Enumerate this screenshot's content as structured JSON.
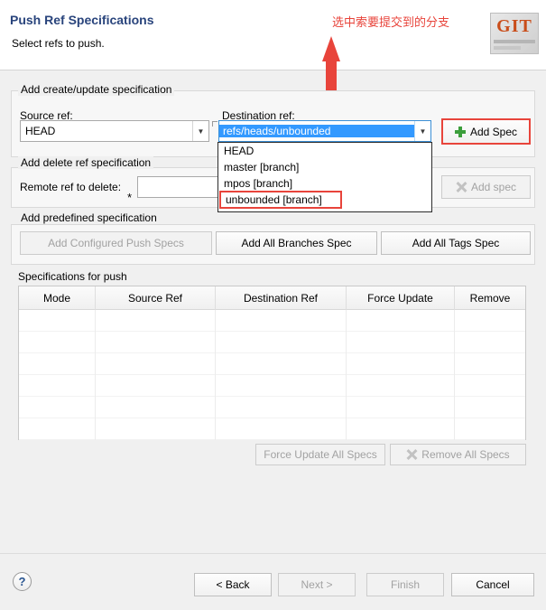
{
  "header": {
    "title": "Push Ref Specifications",
    "subtitle": "Select refs to push.",
    "logo_text": "GIT"
  },
  "annotation": {
    "text": "选中索要提交到的分支",
    "color": "#e8443b"
  },
  "groups": {
    "create_update": {
      "title": "Add create/update specification",
      "source_ref_label": "Source ref:",
      "source_ref_value": "HEAD",
      "destination_ref_label": "Destination ref:",
      "destination_ref_value": "refs/heads/unbounded",
      "add_spec_button": "Add Spec",
      "dropdown_options": [
        "HEAD",
        "master [branch]",
        "mpos [branch]",
        "unbounded [branch]"
      ],
      "dropdown_selected": "unbounded [branch]"
    },
    "delete_ref": {
      "title": "Add delete ref specification",
      "remote_ref_label": "Remote ref to delete:",
      "remote_ref_value": "",
      "required_marker": "*",
      "add_spec_button": "Add spec"
    },
    "predefined": {
      "title": "Add predefined specification",
      "add_configured_button": "Add Configured Push Specs",
      "add_all_branches_button": "Add All Branches Spec",
      "add_all_tags_button": "Add All Tags Spec"
    },
    "specifications": {
      "title": "Specifications for push",
      "columns": [
        "Mode",
        "Source Ref",
        "Destination Ref",
        "Force Update",
        "Remove"
      ],
      "rows": [],
      "force_update_all_button": "Force Update All Specs",
      "remove_all_button": "Remove All Specs"
    }
  },
  "footer": {
    "help_icon": "?",
    "back_button": "< Back",
    "next_button": "Next >",
    "finish_button": "Finish",
    "cancel_button": "Cancel"
  }
}
